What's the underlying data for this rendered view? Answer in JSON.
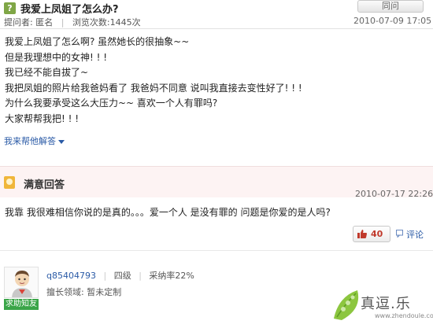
{
  "question": {
    "icon_label": "?",
    "title": "我爱上凤姐了怎么办?",
    "ask_button": "同问",
    "meta": {
      "asker_label": "提问者:",
      "asker": "匿名",
      "views": "浏览次数:1445次"
    },
    "date": "2010-07-09 17:05",
    "body_lines": [
      "我爱上凤姐了怎么啊? 虽然她长的很抽象~~",
      "但是我理想中的女神! ! !",
      "我已经不能自拔了~",
      "我把凤姐的照片给我爸妈看了 我爸妈不同意 说叫我直接去变性好了! ! !",
      "为什么我要承受这么大压力~~ 喜欢一个人有罪吗?",
      "大家帮帮我把! ! !"
    ],
    "help_link": "我来帮他解答"
  },
  "best_answer": {
    "section_title": "满意回答",
    "date": "2010-07-17 22:26",
    "body": "我靠 我很难相信你说的是真的。。。爱一个人 是没有罪的   问题是你爱的是人吗?",
    "votes": "40",
    "comment_label": "评论"
  },
  "answerer": {
    "avatar_caption": "求助知友",
    "username": "q85404793",
    "level": "四级",
    "adoption_rate": "采纳率22%",
    "field": "擅长领域: 暂未定制"
  },
  "watermark": {
    "text": "真逗.乐",
    "url": "www.zhendoule.com"
  },
  "colors": {
    "link": "#2a5aa6",
    "vote_count": "#c0392b",
    "best_panel_bg": "#fdf3f3",
    "question_icon": "#7fa646"
  }
}
